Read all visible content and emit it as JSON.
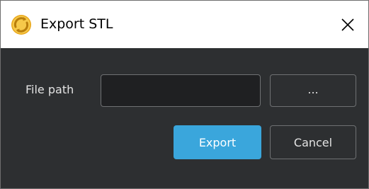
{
  "window": {
    "title": "Export STL",
    "app_icon": "rotate-arrows-logo-icon",
    "close_icon": "close-icon"
  },
  "form": {
    "file_path_label": "File path",
    "file_path_value": "",
    "browse_label": "...",
    "export_label": "Export",
    "cancel_label": "Cancel"
  },
  "colors": {
    "accent": "#3aa6dc",
    "background": "#2d2f31",
    "input_background": "#1f2022",
    "border": "#6f7173",
    "logo": "#e9a81d"
  }
}
